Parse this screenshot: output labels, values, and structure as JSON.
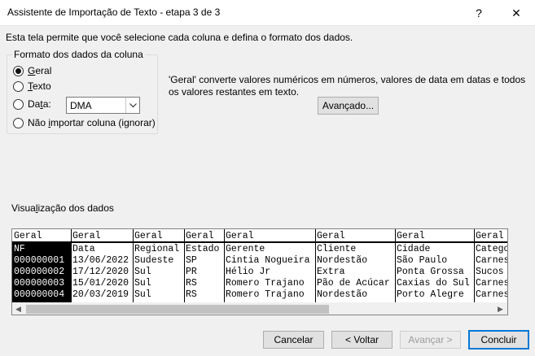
{
  "window": {
    "title": "Assistente de Importação de Texto - etapa 3 de 3",
    "help_glyph": "?",
    "close_glyph": "✕"
  },
  "intro": "Esta tela permite que você selecione cada coluna e defina o formato dos dados.",
  "column_format": {
    "legend": "Formato dos dados da coluna",
    "options": [
      {
        "label": "Geral",
        "checked": true
      },
      {
        "label": "Texto",
        "checked": false
      },
      {
        "label": "Data:",
        "checked": false
      },
      {
        "label": "Não importar coluna (ignorar)",
        "checked": false
      }
    ],
    "date_format": {
      "value": "DMA",
      "options": [
        "DMA"
      ]
    }
  },
  "description": "'Geral' converte valores numéricos em números, valores de data em datas e todos os valores restantes em texto.",
  "buttons": {
    "advanced": "Avançado...",
    "cancel": "Cancelar",
    "back": "< Voltar",
    "next": "Avançar >",
    "finish": "Concluir"
  },
  "preview": {
    "label": "Visualização dos dados",
    "headers": [
      "Geral",
      "Geral",
      "Geral",
      "Geral",
      "Geral",
      "Geral",
      "Geral",
      "Geral"
    ],
    "rows": [
      [
        "NF",
        "Data",
        "Regional",
        "Estado",
        "Gerente",
        "Cliente",
        "Cidade",
        "Catego"
      ],
      [
        "000000001",
        "13/06/2022",
        "Sudeste",
        "SP",
        "Cintia Nogueira",
        "Nordestão",
        "São Paulo",
        "Carnes"
      ],
      [
        "000000002",
        "17/12/2020",
        "Sul",
        "PR",
        "Hélio Jr",
        "Extra",
        "Ponta Grossa",
        "Sucos"
      ],
      [
        "000000003",
        "15/01/2020",
        "Sul",
        "RS",
        "Romero Trajano",
        "Pão de Acúcar",
        "Caxias do Sul",
        "Carnes"
      ],
      [
        "000000004",
        "20/03/2019",
        "Sul",
        "RS",
        "Romero Trajano",
        "Nordestão",
        "Porto Alegre",
        "Carnes"
      ]
    ]
  },
  "icons": {
    "scroll_up": "▲",
    "scroll_down": "▼",
    "scroll_left": "◀",
    "scroll_right": "▶",
    "dropdown": "⌄"
  },
  "colors": {
    "accent": "#0078d7",
    "background": "#f0f0f0"
  }
}
